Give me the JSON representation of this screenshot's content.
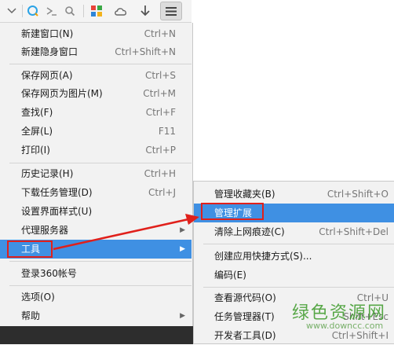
{
  "toolbar": {
    "icons": [
      "chevron-down-icon",
      "search-q-icon",
      "cloud-query-icon",
      "magnifier-icon",
      "apps-grid-icon",
      "cloud-icon",
      "download-arrow-icon",
      "menu-hamburger-icon"
    ]
  },
  "menu": {
    "items": [
      {
        "label": "新建窗口(N)",
        "shortcut": "Ctrl+N"
      },
      {
        "label": "新建隐身窗口",
        "shortcut": "Ctrl+Shift+N"
      },
      {
        "label": "保存网页(A)",
        "shortcut": "Ctrl+S"
      },
      {
        "label": "保存网页为图片(M)",
        "shortcut": "Ctrl+M"
      },
      {
        "label": "查找(F)",
        "shortcut": "Ctrl+F"
      },
      {
        "label": "全屏(L)",
        "shortcut": "F11"
      },
      {
        "label": "打印(I)",
        "shortcut": "Ctrl+P"
      },
      {
        "label": "历史记录(H)",
        "shortcut": "Ctrl+H"
      },
      {
        "label": "下载任务管理(D)",
        "shortcut": "Ctrl+J"
      },
      {
        "label": "设置界面样式(U)",
        "shortcut": ""
      },
      {
        "label": "代理服务器",
        "shortcut": ""
      },
      {
        "label": "工具",
        "shortcut": ""
      },
      {
        "label": "登录360帐号",
        "shortcut": ""
      },
      {
        "label": "选项(O)",
        "shortcut": ""
      },
      {
        "label": "帮助",
        "shortcut": ""
      }
    ]
  },
  "submenu": {
    "items": [
      {
        "label": "管理收藏夹(B)",
        "shortcut": "Ctrl+Shift+O"
      },
      {
        "label": "管理扩展",
        "shortcut": ""
      },
      {
        "label": "清除上网痕迹(C)",
        "shortcut": "Ctrl+Shift+Del"
      },
      {
        "label": "创建应用快捷方式(S)...",
        "shortcut": ""
      },
      {
        "label": "编码(E)",
        "shortcut": ""
      },
      {
        "label": "查看源代码(O)",
        "shortcut": "Ctrl+U"
      },
      {
        "label": "任务管理器(T)",
        "shortcut": "Shift+Esc"
      },
      {
        "label": "开发者工具(D)",
        "shortcut": "Ctrl+Shift+I"
      }
    ]
  },
  "watermark": {
    "title": "绿色资源网",
    "url": "www.downcc.com"
  },
  "colors": {
    "highlight": "#3f90e3",
    "annotation_red": "#e0201b",
    "menu_bg": "#f2f2f2"
  }
}
